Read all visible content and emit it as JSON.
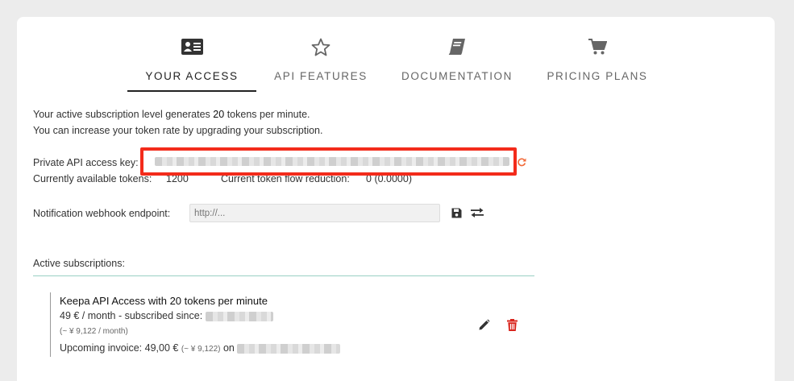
{
  "tabs": [
    {
      "label": "YOUR ACCESS",
      "icon": "id-card-icon",
      "active": true
    },
    {
      "label": "API FEATURES",
      "icon": "star-outline-icon",
      "active": false
    },
    {
      "label": "DOCUMENTATION",
      "icon": "book-icon",
      "active": false
    },
    {
      "label": "PRICING PLANS",
      "icon": "shopping-cart-icon",
      "active": false
    }
  ],
  "intro": {
    "line1_prefix": "Your active subscription level generates",
    "tokens_per_minute": "20",
    "line1_suffix": "tokens per minute.",
    "line2": "You can increase your token rate by upgrading your subscription."
  },
  "access_key": {
    "label": "Private API access key:",
    "highlight_color": "#f32b1b"
  },
  "tokens": {
    "available_label": "Currently available tokens:",
    "available_value": "1200",
    "reduction_label": "Current token flow reduction:",
    "reduction_value": "0",
    "reduction_detail": "(0.0000)"
  },
  "webhook": {
    "label": "Notification webhook endpoint:",
    "placeholder": "http://..."
  },
  "subscriptions": {
    "header": "Active subscriptions:",
    "items": [
      {
        "title": "Keepa API Access with 20 tokens per minute",
        "price": "49 € / month",
        "separator": " - ",
        "since_label": "subscribed since:",
        "yen_price": "(~ ¥ 9,122 / month)",
        "invoice_label": "Upcoming invoice:",
        "invoice_amount": "49,00 €",
        "invoice_yen": "(~ ¥ 9,122)",
        "invoice_on": "on"
      }
    ]
  },
  "colors": {
    "accent_teal": "#9ad0c4",
    "delete_red": "#d9251d",
    "refresh_orange": "#f26b3a"
  }
}
